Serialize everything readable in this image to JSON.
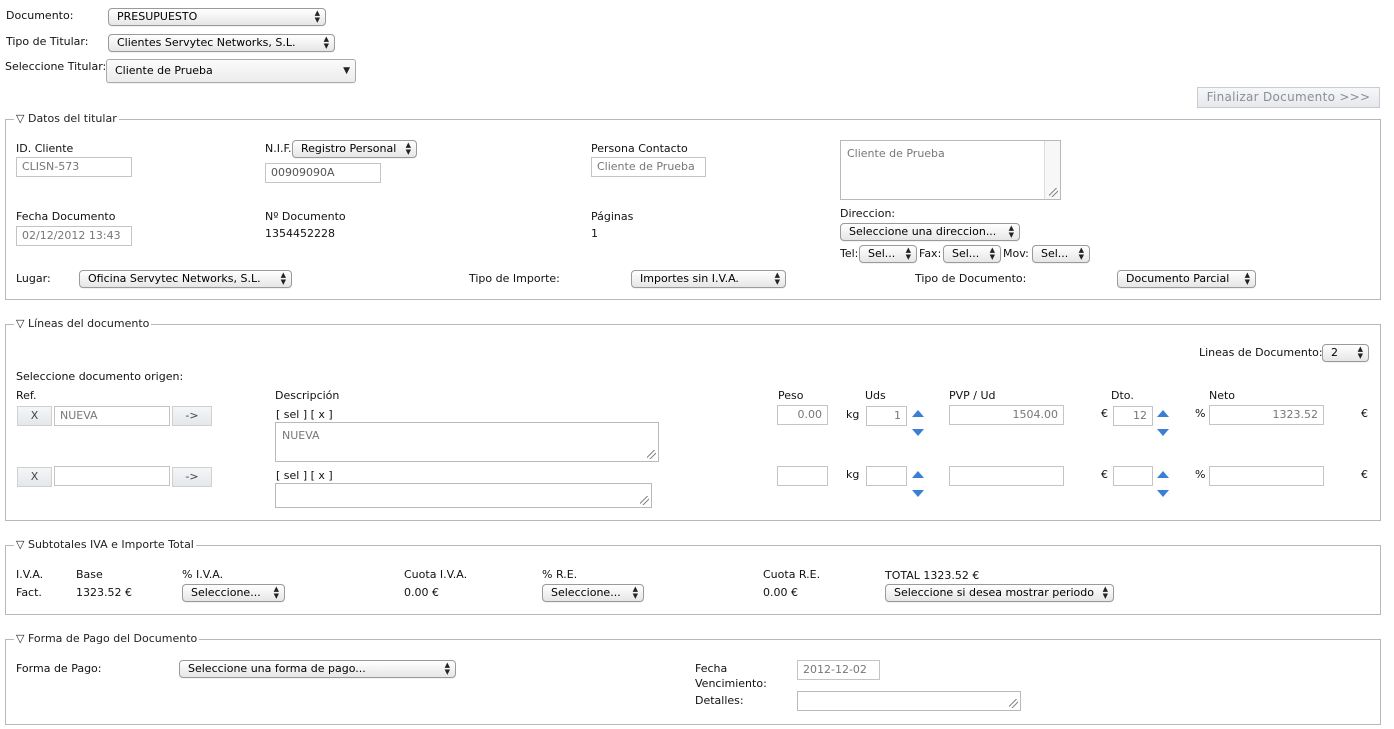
{
  "top": {
    "documento_label": "Documento:",
    "documento_value": "PRESUPUESTO",
    "tipo_titular_label": "Tipo de Titular:",
    "tipo_titular_value": "Clientes Servytec Networks, S.L.",
    "titular_label": "Seleccione Titular:",
    "titular_value": "Cliente de Prueba",
    "finalizar_label": "Finalizar Documento >>>"
  },
  "datos": {
    "legend": "Datos del titular",
    "id_cliente_label": "ID. Cliente",
    "id_cliente_value": "CLISN-573",
    "nif_label": "N.I.F.",
    "nif_select": "Registro Personal",
    "nif_value": "00909090A",
    "persona_label": "Persona Contacto",
    "persona_value": "Cliente de Prueba",
    "notes_value": "Cliente de Prueba",
    "fecha_label": "Fecha Documento",
    "fecha_value": "02/12/2012 13:43",
    "num_doc_label": "Nº Documento",
    "num_doc_value": "1354452228",
    "paginas_label": "Páginas",
    "paginas_value": "1",
    "direccion_label": "Direccion:",
    "direccion_value": "Seleccione una direccion...",
    "tel_label": "Tel:",
    "tel_value": "Sel...",
    "fax_label": "Fax:",
    "fax_value": "Sel...",
    "mov_label": "Mov:",
    "mov_value": "Sel...",
    "lugar_label": "Lugar:",
    "lugar_value": "Oficina Servytec Networks, S.L.",
    "tipo_importe_label": "Tipo de Importe:",
    "tipo_importe_value": "Importes sin I.V.A.",
    "tipo_documento_label": "Tipo de Documento:",
    "tipo_documento_value": "Documento Parcial"
  },
  "lineas": {
    "legend": "Líneas del documento",
    "lineas_count_label": "Lineas de Documento:",
    "lineas_count_value": "2",
    "origen_label": "Seleccione documento origen:",
    "headers": {
      "ref": "Ref.",
      "descripcion": "Descripción",
      "peso": "Peso",
      "uds": "Uds",
      "pvp": "PVP / Ud",
      "dto": "Dto.",
      "neto": "Neto"
    },
    "x_label": "X",
    "arrow_label": "->",
    "sel_links": "[ sel ] [ x ]",
    "kg_unit": "kg",
    "euro_unit": "€",
    "pct_unit": "%",
    "rows": [
      {
        "ref": "NUEVA",
        "descripcion": "NUEVA",
        "peso": "0.00",
        "uds": "1",
        "pvp": "1504.00",
        "dto": "12",
        "neto": "1323.52"
      },
      {
        "ref": "",
        "descripcion": "",
        "peso": "",
        "uds": "",
        "pvp": "",
        "dto": "",
        "neto": ""
      }
    ]
  },
  "subtotales": {
    "legend": "Subtotales IVA e Importe Total",
    "iva_label": "I.V.A.",
    "fact_label": "Fact.",
    "base_label": "Base",
    "base_value": "1323.52 €",
    "pct_iva_label": "% I.V.A.",
    "pct_iva_value": "Seleccione...",
    "cuota_iva_label": "Cuota I.V.A.",
    "cuota_iva_value": "0.00 €",
    "pct_re_label": "% R.E.",
    "pct_re_value": "Seleccione...",
    "cuota_re_label": "Cuota R.E.",
    "cuota_re_value": "0.00 €",
    "total_label": "TOTAL 1323.52 €",
    "periodo_value": "Seleccione si desea mostrar periodo"
  },
  "pago": {
    "legend": "Forma de Pago del Documento",
    "forma_label": "Forma de Pago:",
    "forma_value": "Seleccione una forma de pago...",
    "fecha_venc_label1": "Fecha",
    "fecha_venc_label2": "Vencimiento:",
    "fecha_venc_value": "2012-12-02",
    "detalles_label": "Detalles:"
  },
  "colors": {
    "spinner": "#3a7fd5",
    "border": "#b8b8b8"
  }
}
